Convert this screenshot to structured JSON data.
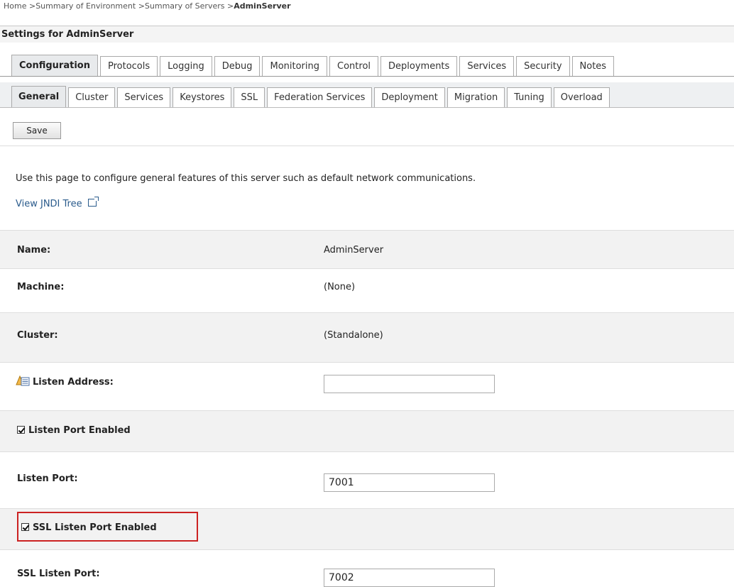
{
  "breadcrumb": {
    "items": [
      "Home",
      "Summary of Environment",
      "Summary of Servers"
    ],
    "current": "AdminServer",
    "separator": ">"
  },
  "settings_title": "Settings for AdminServer",
  "tabs_primary": [
    {
      "label": "Configuration",
      "active": true
    },
    {
      "label": "Protocols",
      "active": false
    },
    {
      "label": "Logging",
      "active": false
    },
    {
      "label": "Debug",
      "active": false
    },
    {
      "label": "Monitoring",
      "active": false
    },
    {
      "label": "Control",
      "active": false
    },
    {
      "label": "Deployments",
      "active": false
    },
    {
      "label": "Services",
      "active": false
    },
    {
      "label": "Security",
      "active": false
    },
    {
      "label": "Notes",
      "active": false
    }
  ],
  "tabs_secondary": [
    {
      "label": "General",
      "active": true
    },
    {
      "label": "Cluster",
      "active": false
    },
    {
      "label": "Services",
      "active": false
    },
    {
      "label": "Keystores",
      "active": false
    },
    {
      "label": "SSL",
      "active": false
    },
    {
      "label": "Federation Services",
      "active": false
    },
    {
      "label": "Deployment",
      "active": false
    },
    {
      "label": "Migration",
      "active": false
    },
    {
      "label": "Tuning",
      "active": false
    },
    {
      "label": "Overload",
      "active": false
    }
  ],
  "save_label": "Save",
  "intro_text": "Use this page to configure general features of this server such as default network communications.",
  "jndi_link": "View JNDI Tree",
  "form": {
    "name": {
      "label": "Name:",
      "value": "AdminServer"
    },
    "machine": {
      "label": "Machine:",
      "value": "(None)"
    },
    "cluster": {
      "label": "Cluster:",
      "value": "(Standalone)"
    },
    "listen_address": {
      "label": "Listen Address:",
      "value": ""
    },
    "listen_port_enabled": {
      "label": "Listen Port Enabled",
      "checked": true
    },
    "listen_port": {
      "label": "Listen Port:",
      "value": "7001"
    },
    "ssl_listen_port_enabled": {
      "label": "SSL Listen Port Enabled",
      "checked": true
    },
    "ssl_listen_port": {
      "label": "SSL Listen Port:",
      "value": "7002"
    }
  },
  "colors": {
    "highlight_border": "#cc2222",
    "link": "#2a5b8c",
    "active_tab_bg": "#e8eaec"
  }
}
